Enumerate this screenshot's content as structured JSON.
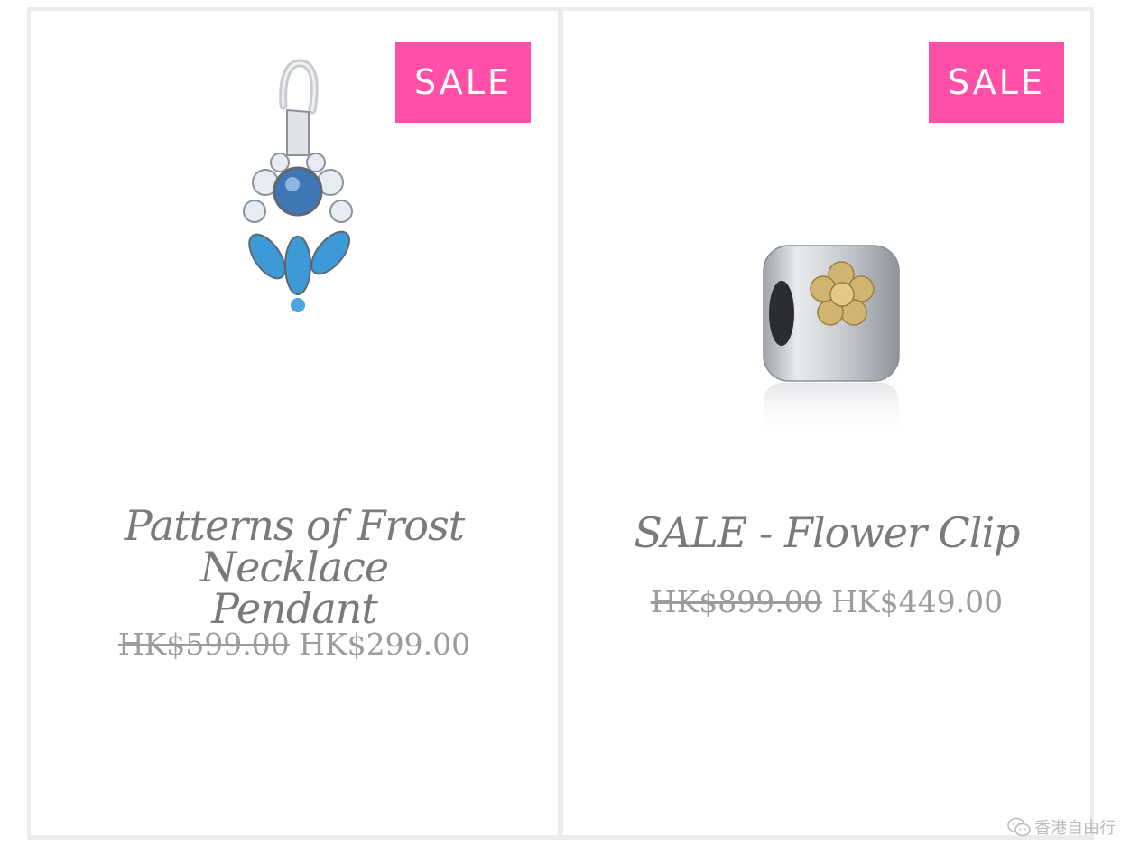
{
  "products": [
    {
      "badge": "SALE",
      "title_line1": "Patterns of Frost Necklace",
      "title_line2": "Pendant",
      "old_price": "HK$599.00",
      "new_price": "HK$299.00"
    },
    {
      "badge": "SALE",
      "title_line1": "SALE - Flower Clip",
      "old_price": "HK$899.00",
      "new_price": "HK$449.00"
    }
  ],
  "watermark": {
    "text": "香港自由行"
  },
  "colors": {
    "badge": "#ff4fa7",
    "title": "#7a7a7a",
    "price": "#9c9c9c",
    "border": "#ececec"
  }
}
